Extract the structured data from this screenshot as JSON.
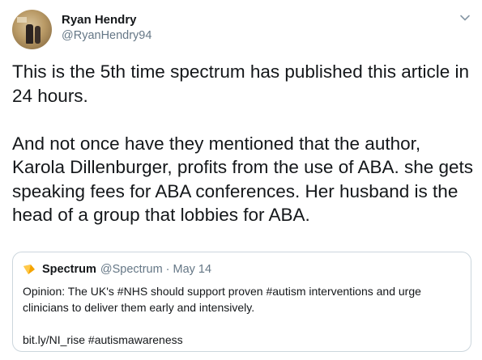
{
  "author": {
    "name": "Ryan Hendry",
    "handle": "@RyanHendry94"
  },
  "tweet": {
    "text": "This is the 5th time spectrum has published this article in 24 hours.\n\nAnd not once have they mentioned that the author, Karola Dillenburger, profits from the use of ABA. she gets speaking fees for ABA conferences. Her husband is the head of a group that lobbies for ABA."
  },
  "quoted_tweet": {
    "name": "Spectrum",
    "handle": "@Spectrum",
    "separator": "·",
    "date": "May 14",
    "text": "Opinion: The UK's #NHS should support proven #autism interventions and urge clinicians to deliver them early and intensively.\n\nbit.ly/NI_rise #autismawareness",
    "logo_color": "#f4a300"
  },
  "icons": {
    "menu": "chevron-down-icon",
    "quoted_logo": "spectrum-logo-icon"
  },
  "colors": {
    "text": "#14171a",
    "secondary": "#657786",
    "border": "#ccd6dd"
  }
}
